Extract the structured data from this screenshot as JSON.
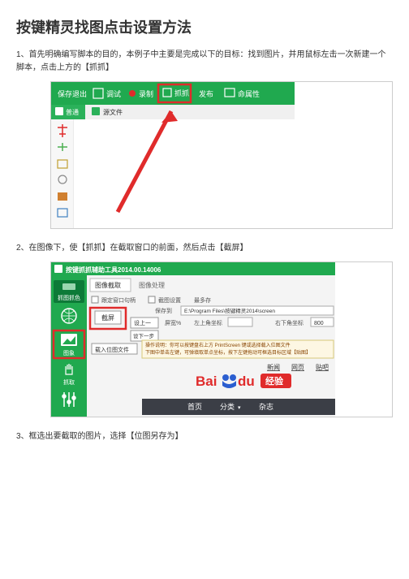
{
  "title": "按键精灵找图点击设置方法",
  "step1": "1、首先明确编写脚本的目的，本例子中主要是完成以下的目标：找到图片，并用鼠标左击一次新建一个脚本，点击上方的【抓抓】",
  "step2": "2、在图像下，使【抓抓】在截取窗口的前面，然后点击【截屏】",
  "step3": "3、框选出要截取的图片，选择【位图另存为】",
  "shot1": {
    "save_exit": "保存退出",
    "debug": "调试",
    "record": "录制",
    "grab": "抓抓",
    "publish": "发布",
    "prop": "命属性",
    "tab_normal": "普通",
    "tab_source": "源文件"
  },
  "shot2": {
    "app_title": "按键抓抓辅助工具2014.00.14006",
    "tab_fetch": "抓图抓色",
    "tab_capture": "图像截取",
    "tab_process": "图像处理",
    "window_sync": "跟定窗口句柄",
    "cap_setting": "截图设置",
    "more_many": "最多存",
    "save_to": "保存到",
    "save_path": "E:\\Program Files\\按键精灵2014\\screen",
    "btn_cap": "截屏",
    "set_tl": "设上一",
    "label_screen": "屏宽%",
    "label_tl": "左上角坐标",
    "label_br": "右下角坐标",
    "val_br": "800",
    "set_br": "设下一步",
    "btn_load": "载入位图文件",
    "side_img": "图象",
    "side_grab": "抓取",
    "hint1": "操作说明：你可以按键盘右上方 PrintScreen 键或选择载入位图文件",
    "hint2": "下图中单击左键，可弹填取单点坐标，按下左键拖动可框选目标区域【贴图】",
    "nav_news": "新闻",
    "nav_web": "网页",
    "nav_tieba": "贴吧",
    "baidu_txt": "经验",
    "ftr_home": "首页",
    "ftr_cat": "分类",
    "ftr_mix": "杂志",
    "arrow": "▾"
  }
}
